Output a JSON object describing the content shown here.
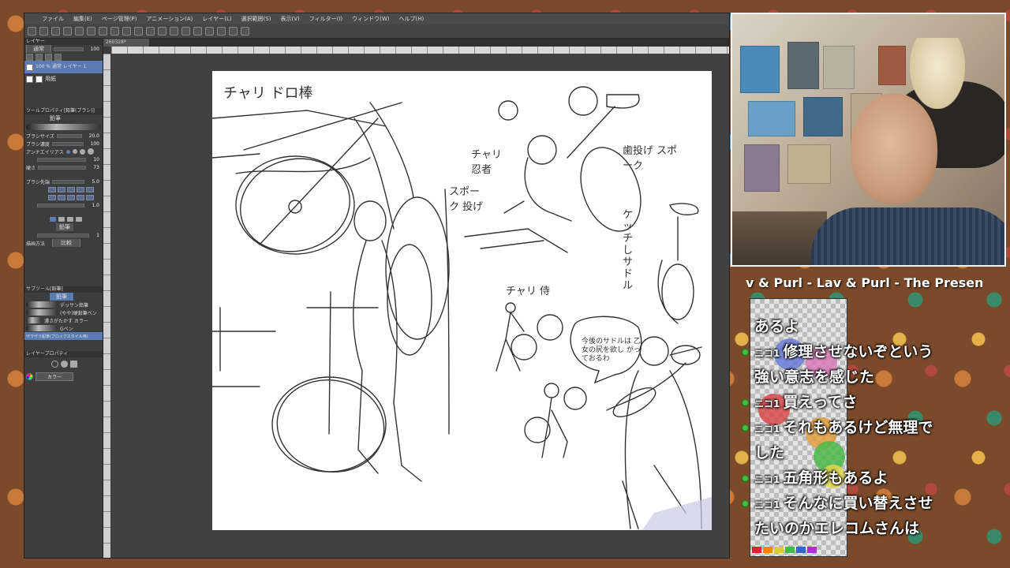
{
  "app": {
    "menu": [
      "ファイル",
      "編集(E)",
      "ページ管理(P)",
      "アニメーション(A)",
      "レイヤー(L)",
      "選択範囲(S)",
      "表示(V)",
      "フィルター(I)",
      "ウィンドウ(W)",
      "ヘルプ(H)"
    ],
    "tab_label": "260328*",
    "left_panel": {
      "layer_header": "レイヤー",
      "blend_mode": "通常",
      "opacity": "100",
      "layer_name": "100 % 通常 レイヤー 1",
      "paper_layer": "用紙",
      "tool_property_header": "ツールプロパティ[鉛筆(ブラシ)]",
      "brush_name": "鉛筆",
      "size_label": "ブラシサイズ",
      "size_value": "20.0",
      "density_label": "ブラシ濃度",
      "density_value": "100",
      "aa_label": "アンチエイリアス",
      "v10": "10",
      "hardness_label": "硬さ",
      "hardness_value": "73",
      "pattern_label": "ブラシ先端",
      "pattern_value": "5.0",
      "hatch_val": "1.0",
      "draw_label": "描画方法",
      "draw_value": "比較",
      "pencil_label": "鉛筆",
      "sub_tool_header": "サブツール[鉛筆]",
      "sub_tools": [
        "デッサン鉛筆",
        "(やや)硬鉛筆ペン",
        "濃さがたかす カラー",
        "Gペン",
        "ザラザラ鉛筆(ブロックスタイル用)"
      ],
      "layer_prop_header": "レイヤープロパティ",
      "color_label": "カラー"
    },
    "canvas": {
      "title_scribble": "チャリ ドロ棒",
      "label_ninja": "チャリ 忍者",
      "label_spoke": "スポーク 投げ",
      "label_teeth": "歯投げ スポーク",
      "label_ketsu": "ケッチ しサドル",
      "label_samurai": "チャリ 侍",
      "speech": "今後のサドルは 乙女の尻を欲し がっておるわ"
    }
  },
  "stream": {
    "now_playing": "v & Purl - Lav & Purl - The Present"
  },
  "chat": {
    "source_tag": "ニコ1",
    "messages": [
      {
        "badge": false,
        "source": false,
        "text": "あるよ"
      },
      {
        "badge": true,
        "source": true,
        "text": "修理させないぞという"
      },
      {
        "badge": false,
        "source": false,
        "text": "強い意志を感じた"
      },
      {
        "badge": true,
        "source": true,
        "text": "買えってさ"
      },
      {
        "badge": true,
        "source": true,
        "text": "それもあるけど無理で"
      },
      {
        "badge": false,
        "source": false,
        "text": "した"
      },
      {
        "badge": true,
        "source": true,
        "text": "五角形もあるよ"
      },
      {
        "badge": true,
        "source": true,
        "text": "そんなに買い替えさせ"
      },
      {
        "badge": false,
        "source": false,
        "text": "たいのかエレコムさんは"
      }
    ]
  },
  "colors": {
    "accent": "#5b7bb3",
    "chat_badge": "#3bc43b"
  }
}
